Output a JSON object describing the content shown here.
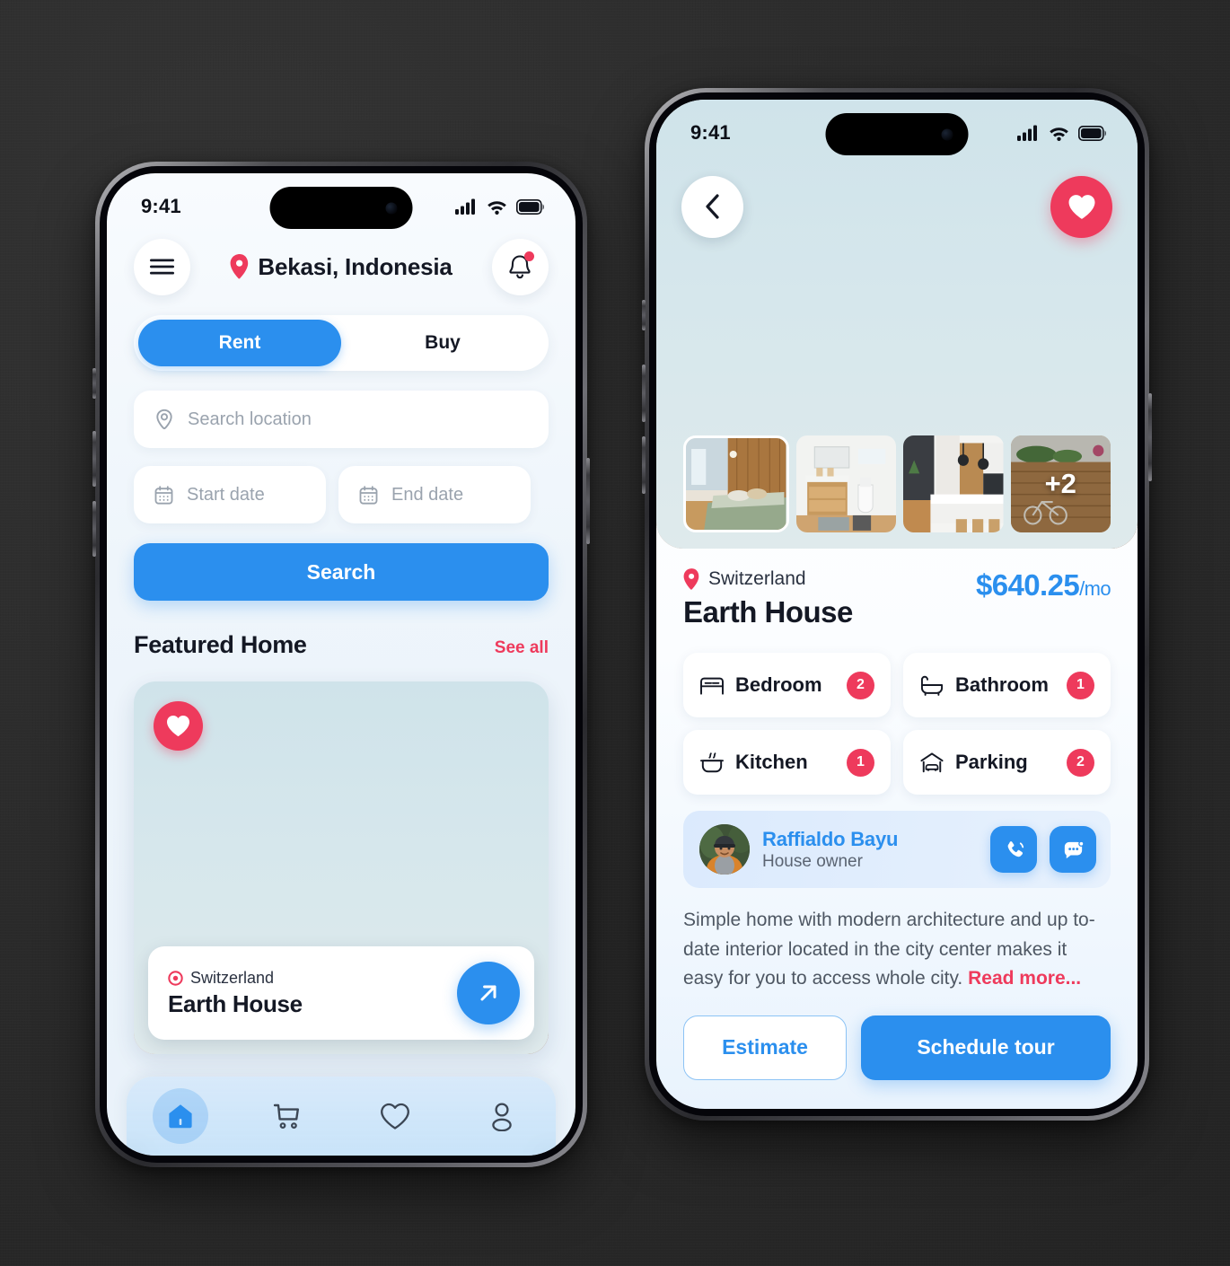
{
  "meta": {
    "accent_blue": "#2b8fee",
    "accent_red": "#ee3a5c",
    "text_dark": "#141824",
    "background": "#2b2b2b"
  },
  "phone1": {
    "status": {
      "time": "9:41",
      "signal": "cellular-signal-icon",
      "wifi": "wifi-icon",
      "battery": "battery-icon"
    },
    "header": {
      "menu_icon": "hamburger-menu-icon",
      "location_icon": "location-pin-icon",
      "location": "Bekasi, Indonesia",
      "bell_icon": "notification-bell-icon"
    },
    "segmented": {
      "options": [
        "Rent",
        "Buy"
      ],
      "selected": "Rent"
    },
    "search": {
      "location_placeholder": "Search location",
      "location_value": "",
      "location_icon": "location-target-icon",
      "start_date_placeholder": "Start date",
      "start_date_value": "",
      "end_date_placeholder": "End date",
      "end_date_value": "",
      "calendar_icon": "calendar-icon",
      "button_label": "Search"
    },
    "featured": {
      "title": "Featured Home",
      "see_all": "See all",
      "card": {
        "favorite_icon": "heart-filled-icon",
        "location_icon": "location-pin-icon",
        "location": "Switzerland",
        "name": "Earth House",
        "go_icon": "arrow-up-right-icon"
      }
    },
    "tabbar": {
      "items": [
        {
          "icon": "home-icon",
          "active": true
        },
        {
          "icon": "shopping-cart-icon",
          "active": false
        },
        {
          "icon": "heart-outline-icon",
          "active": false
        },
        {
          "icon": "user-profile-icon",
          "active": false
        }
      ]
    }
  },
  "phone2": {
    "status": {
      "time": "9:41",
      "signal": "cellular-signal-icon",
      "wifi": "wifi-icon",
      "battery": "battery-icon"
    },
    "hero": {
      "back_icon": "chevron-left-icon",
      "favorite_icon": "heart-filled-icon",
      "thumbnails": [
        {
          "label": "",
          "alt": "bedroom-photo"
        },
        {
          "label": "",
          "alt": "bathroom-photo"
        },
        {
          "label": "",
          "alt": "kitchen-photo"
        },
        {
          "label": "+2",
          "alt": "exterior-photo-more"
        }
      ]
    },
    "detail": {
      "location_icon": "location-pin-icon",
      "location": "Switzerland",
      "name": "Earth House",
      "price": "$640.25",
      "price_period": "/mo"
    },
    "amenities": [
      {
        "icon": "bed-icon",
        "label": "Bedroom",
        "count": "2"
      },
      {
        "icon": "bathtub-icon",
        "label": "Bathroom",
        "count": "1"
      },
      {
        "icon": "cooking-pot-icon",
        "label": "Kitchen",
        "count": "1"
      },
      {
        "icon": "garage-car-icon",
        "label": "Parking",
        "count": "2"
      }
    ],
    "owner": {
      "avatar": "owner-avatar-photo",
      "name": "Raffialdo Bayu",
      "role": "House owner",
      "call_icon": "phone-call-icon",
      "message_icon": "chat-message-icon"
    },
    "description": {
      "text": "Simple home with modern architecture and up to-date interior located in the city center makes it easy for you to access whole city. ",
      "read_more": "Read more..."
    },
    "actions": {
      "secondary": "Estimate",
      "primary": "Schedule tour"
    }
  }
}
